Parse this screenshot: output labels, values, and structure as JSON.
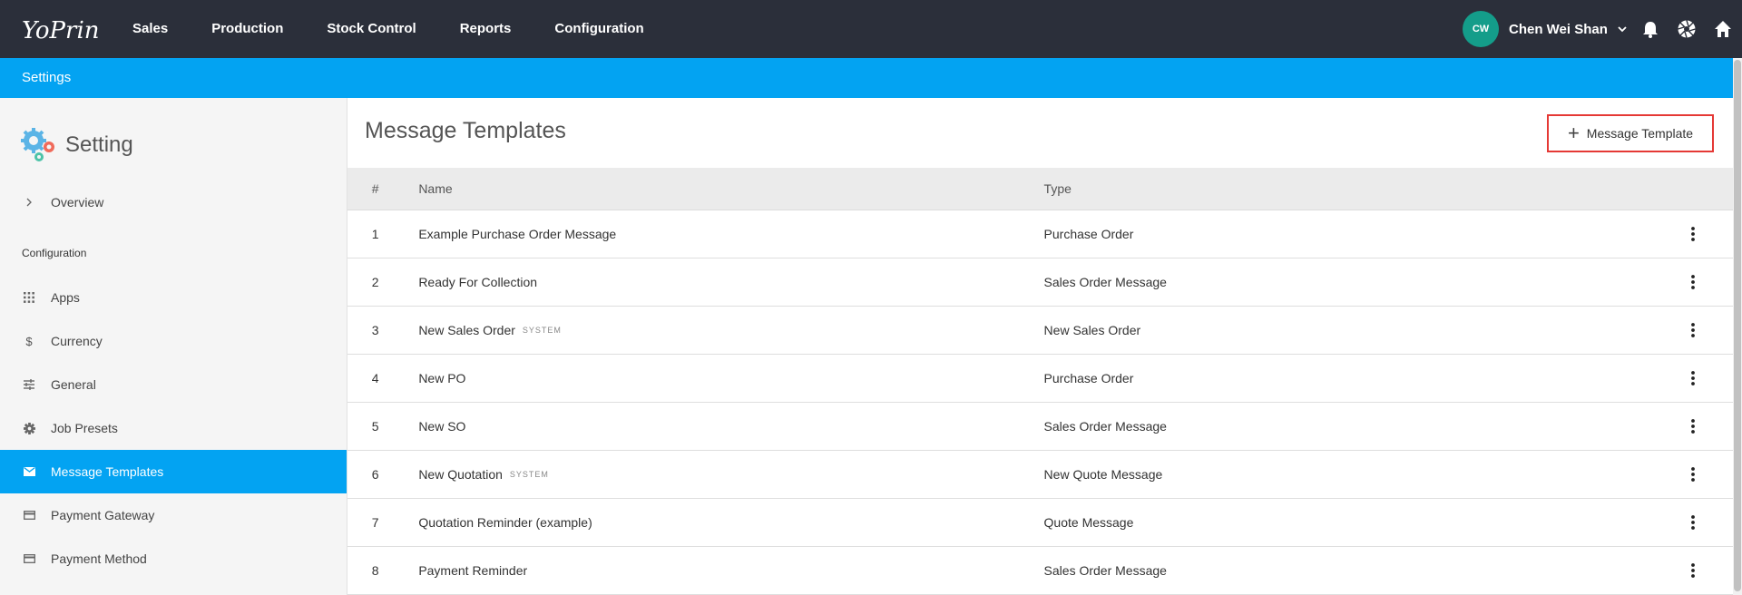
{
  "app": {
    "logo_text": "YoPrint"
  },
  "nav": {
    "items": [
      "Sales",
      "Production",
      "Stock Control",
      "Reports",
      "Configuration"
    ]
  },
  "user": {
    "initials": "CW",
    "name": "Chen Wei Shan"
  },
  "topbar_icons": [
    "bell-icon",
    "aperture-icon",
    "home-icon"
  ],
  "subheader": {
    "title": "Settings"
  },
  "sidebar": {
    "title": "Setting",
    "overview_label": "Overview",
    "section_label": "Configuration",
    "items": [
      {
        "label": "Apps",
        "icon": "apps-grid-icon"
      },
      {
        "label": "Currency",
        "icon": "dollar-icon"
      },
      {
        "label": "General",
        "icon": "sliders-icon"
      },
      {
        "label": "Job Presets",
        "icon": "gear-icon"
      },
      {
        "label": "Message Templates",
        "icon": "envelope-icon",
        "active": true
      },
      {
        "label": "Payment Gateway",
        "icon": "credit-card-icon"
      },
      {
        "label": "Payment Method",
        "icon": "credit-card-icon"
      }
    ]
  },
  "main": {
    "title": "Message Templates",
    "add_button_label": "Message Template",
    "table": {
      "headers": {
        "num": "#",
        "name": "Name",
        "type": "Type"
      },
      "rows": [
        {
          "num": "1",
          "name": "Example Purchase Order Message",
          "system": "",
          "type": "Purchase Order"
        },
        {
          "num": "2",
          "name": "Ready For Collection",
          "system": "",
          "type": "Sales Order Message"
        },
        {
          "num": "3",
          "name": "New Sales Order",
          "system": "SYSTEM",
          "type": "New Sales Order"
        },
        {
          "num": "4",
          "name": "New PO",
          "system": "",
          "type": "Purchase Order"
        },
        {
          "num": "5",
          "name": "New SO",
          "system": "",
          "type": "Sales Order Message"
        },
        {
          "num": "6",
          "name": "New Quotation",
          "system": "SYSTEM",
          "type": "New Quote Message"
        },
        {
          "num": "7",
          "name": "Quotation Reminder (example)",
          "system": "",
          "type": "Quote Message"
        },
        {
          "num": "8",
          "name": "Payment Reminder",
          "system": "",
          "type": "Sales Order Message"
        }
      ]
    }
  },
  "colors": {
    "topbar": "#2b2f3a",
    "accent": "#03a3f2",
    "avatar": "#149d8a",
    "highlight_border": "#e53935"
  }
}
